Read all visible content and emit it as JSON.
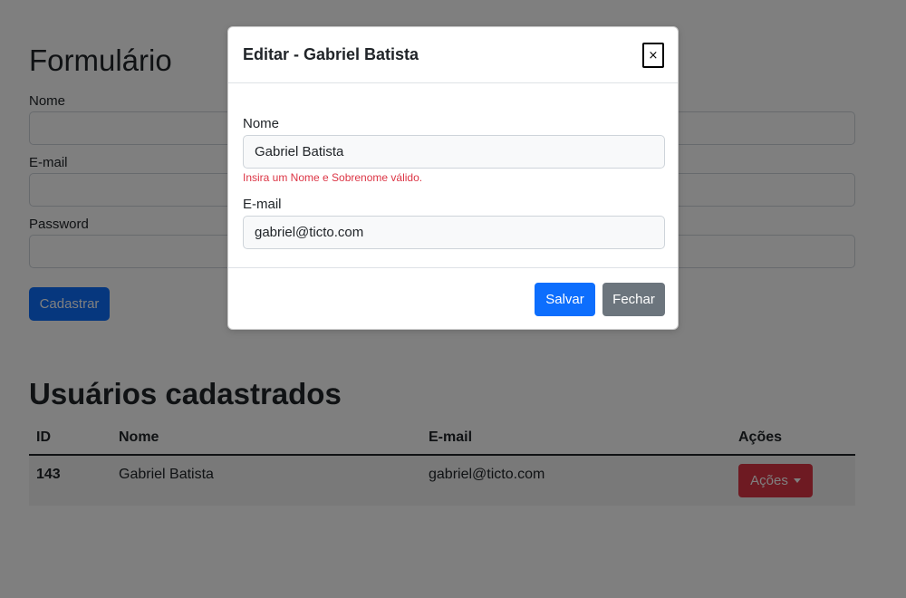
{
  "form": {
    "title": "Formulário",
    "name_label": "Nome",
    "email_label": "E-mail",
    "password_label": "Password",
    "submit_label": "Cadastrar"
  },
  "users": {
    "title": "Usuários cadastrados",
    "columns": [
      "ID",
      "Nome",
      "E-mail",
      "Ações"
    ],
    "rows": [
      {
        "id": "143",
        "name": "Gabriel Batista",
        "email": "gabriel@ticto.com",
        "actions_label": "Ações"
      }
    ]
  },
  "modal": {
    "title": "Editar - Gabriel Batista",
    "close_glyph": "×",
    "name_label": "Nome",
    "name_value": "Gabriel Batista",
    "name_error": "Insira um Nome e Sobrenome válido.",
    "email_label": "E-mail",
    "email_value": "gabriel@ticto.com",
    "save_label": "Salvar",
    "close_label": "Fechar"
  },
  "colors": {
    "primary": "#0d6efd",
    "danger": "#dc3545",
    "secondary": "#6c757d",
    "backdrop": "rgba(0,0,0,0.5)"
  }
}
